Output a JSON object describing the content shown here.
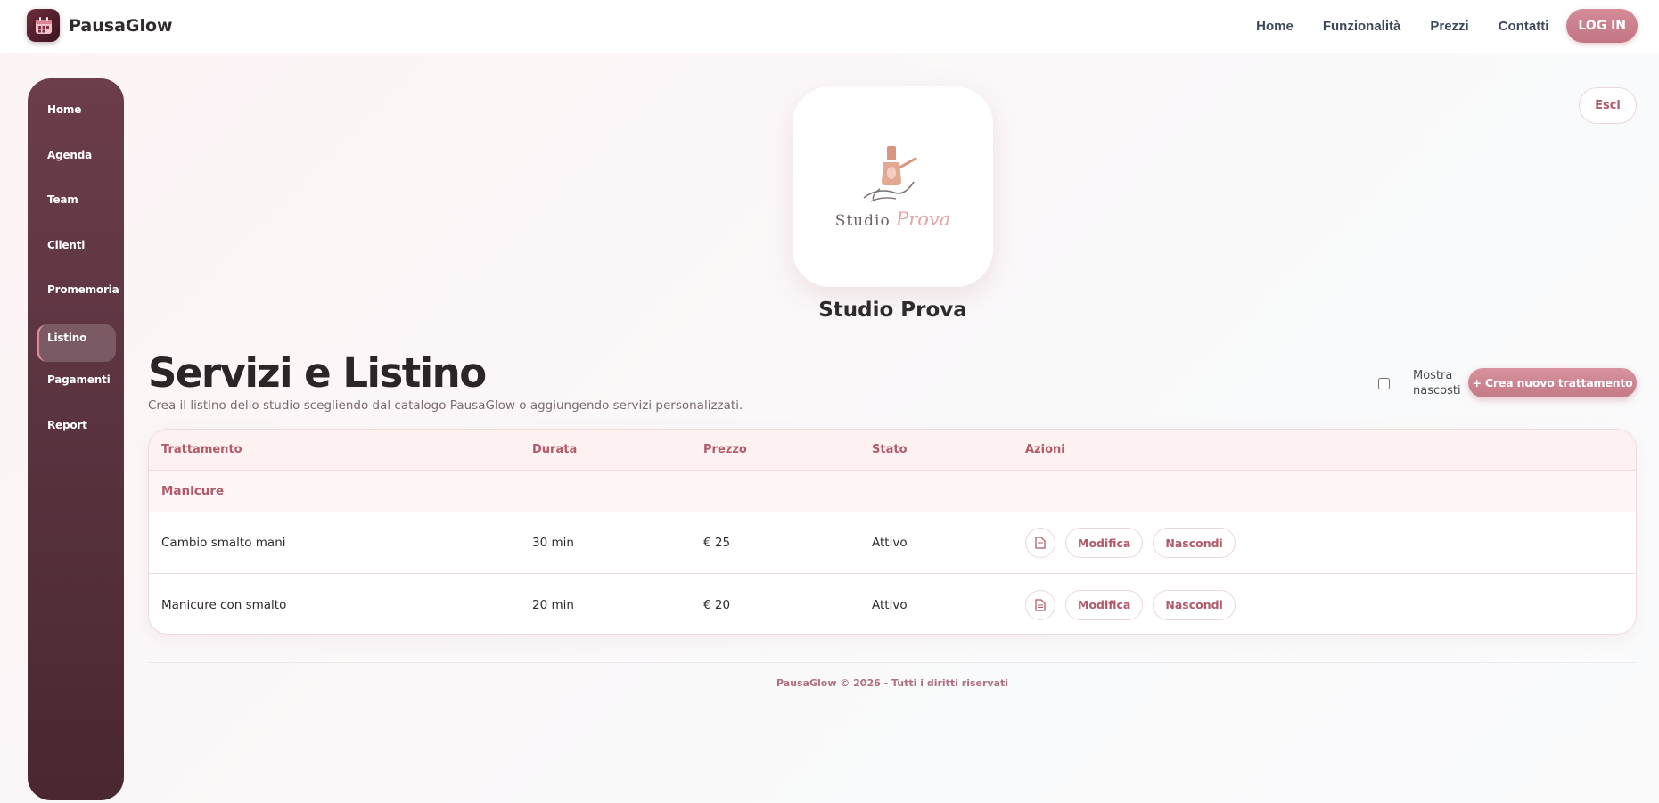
{
  "header": {
    "brand": "PausaGlow",
    "nav": [
      "Home",
      "Funzionalità",
      "Prezzi",
      "Contatti"
    ],
    "login_label": "LOG IN"
  },
  "sidebar": {
    "items": [
      {
        "label": "Home"
      },
      {
        "label": "Agenda"
      },
      {
        "label": "Team"
      },
      {
        "label": "Clienti"
      },
      {
        "label": "Promemoria"
      },
      {
        "label": "Listino",
        "active": true
      },
      {
        "label": "Pagamenti"
      },
      {
        "label": "Report"
      }
    ]
  },
  "esci_label": "Esci",
  "studio": {
    "logo_word1": "Studio",
    "logo_word2": "Prova",
    "name": "Studio Prova"
  },
  "page": {
    "title": "Servizi e Listino",
    "subtitle": "Crea il listino dello studio scegliendo dal catalogo PausaGlow o aggiungendo servizi personalizzati.",
    "show_hidden_label": "Mostra nascosti",
    "create_label": "+ Crea nuovo trattamento"
  },
  "table": {
    "headers": [
      "Trattamento",
      "Durata",
      "Prezzo",
      "Stato",
      "Azioni"
    ],
    "category": "Manicure",
    "rows": [
      {
        "name": "Cambio smalto mani",
        "duration": "30 min",
        "price": "€ 25",
        "status": "Attivo",
        "edit": "Modifica",
        "hide": "Nascondi"
      },
      {
        "name": "Manicure con smalto",
        "duration": "20 min",
        "price": "€ 20",
        "status": "Attivo",
        "edit": "Modifica",
        "hide": "Nascondi"
      }
    ]
  },
  "footer": "PausaGlow © 2026 - Tutti i diritti riservati",
  "colors": {
    "accent": "#c27482",
    "sidebar": "#5a3440",
    "text_accent": "#b05a6a"
  }
}
